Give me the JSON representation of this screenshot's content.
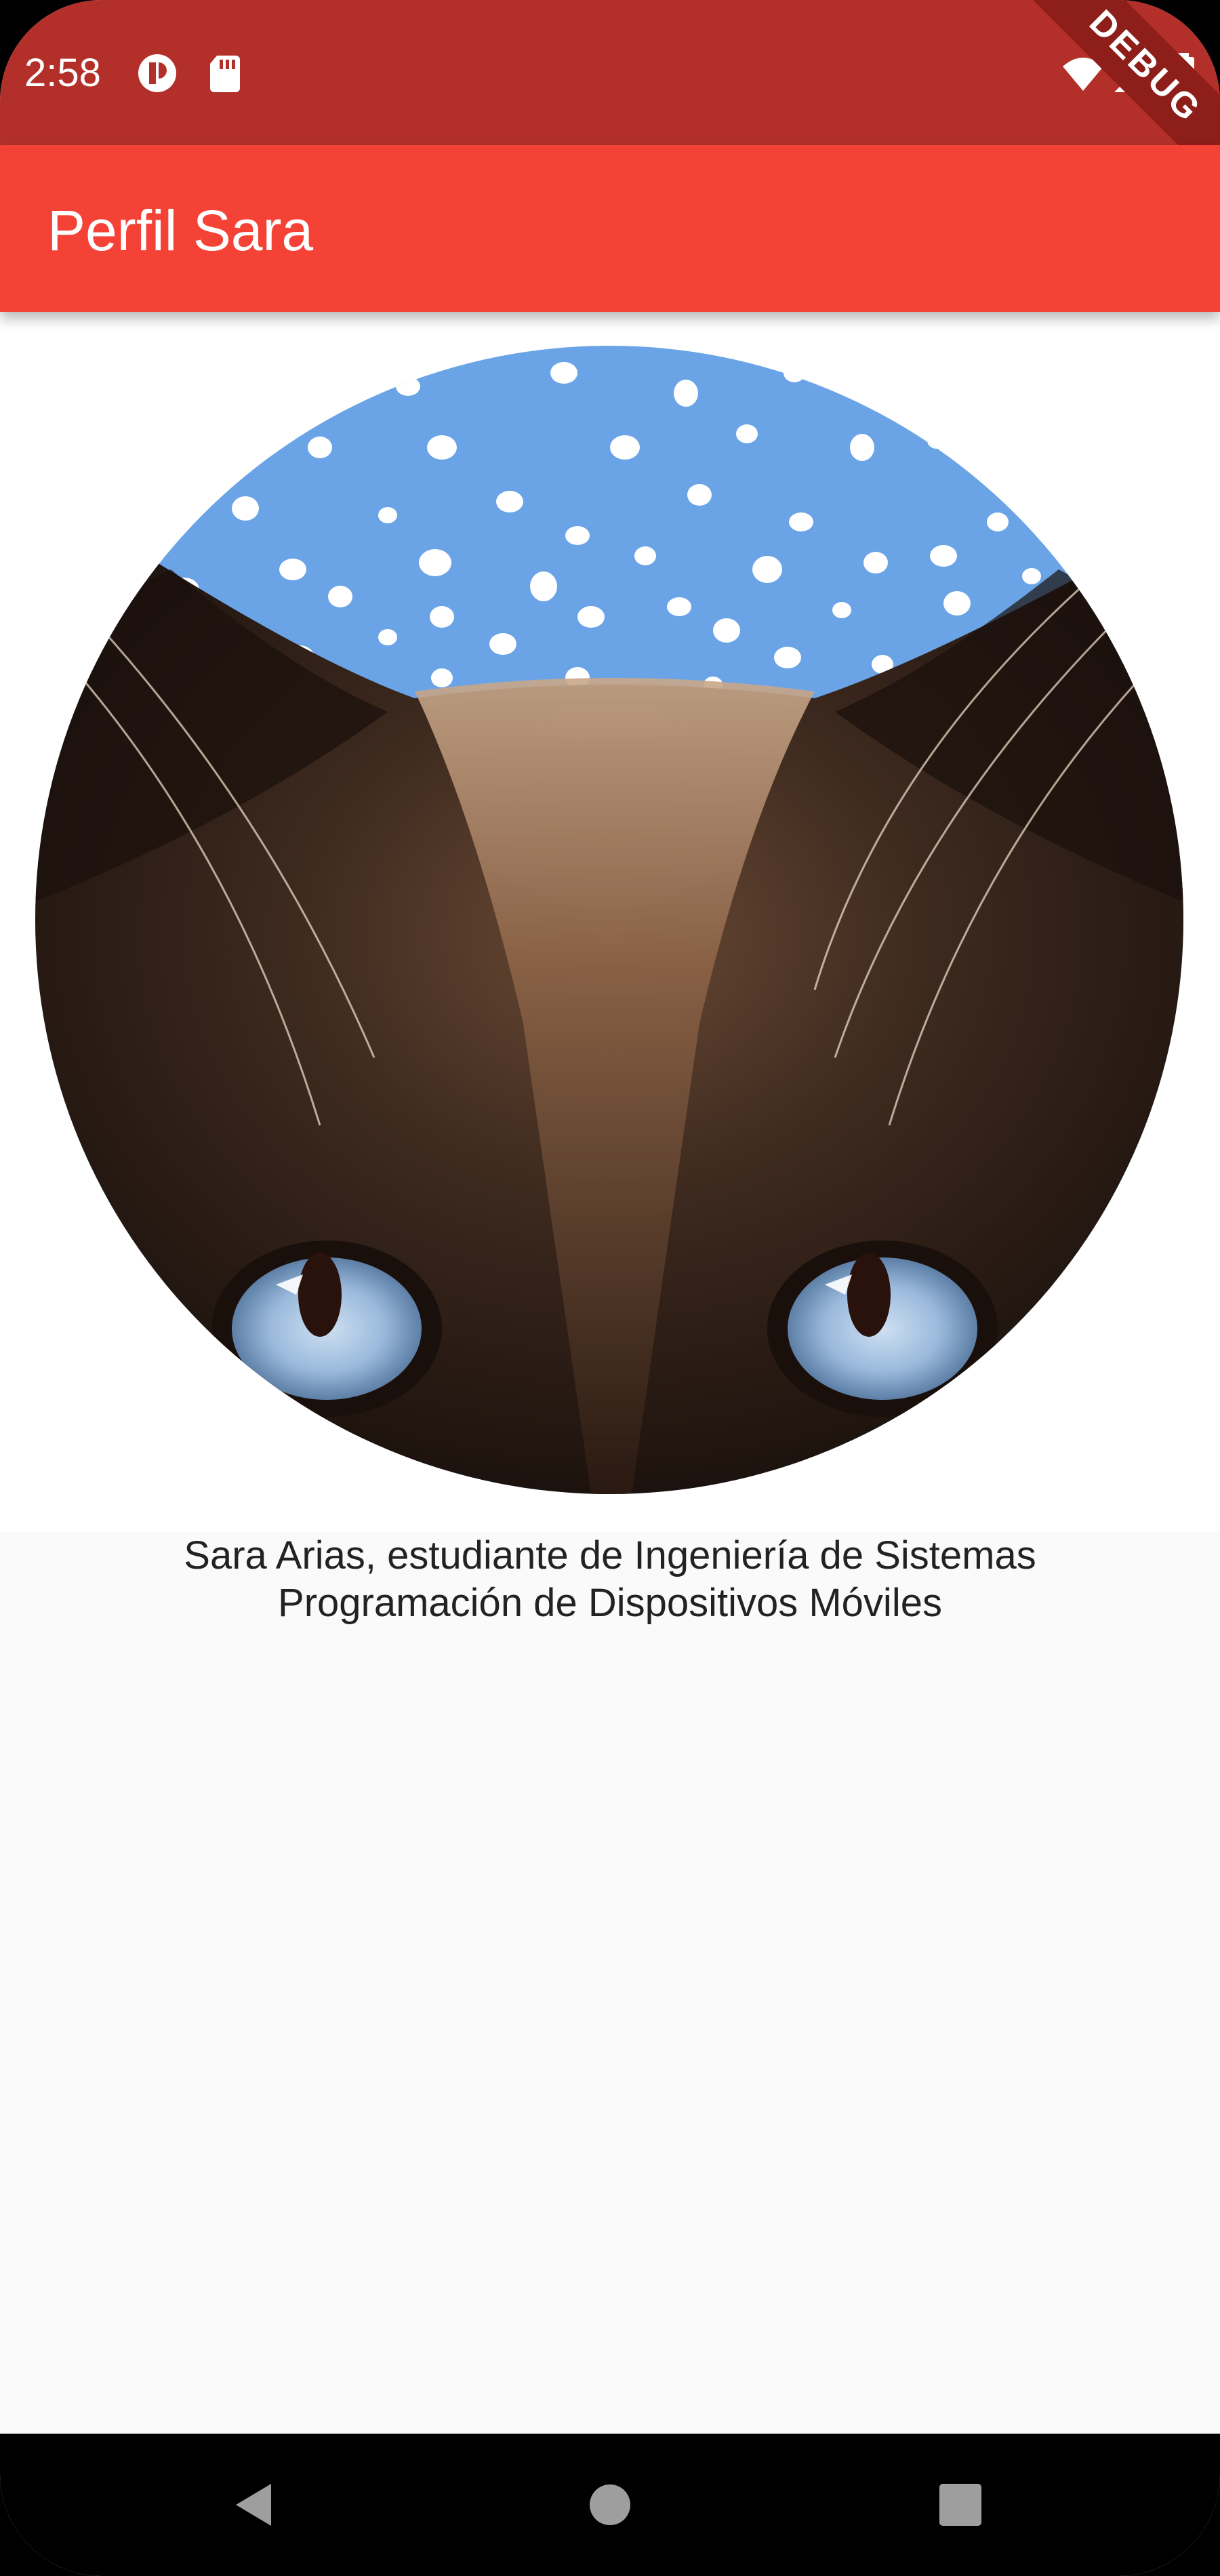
{
  "status_bar": {
    "time": "2:58",
    "icons": [
      "cast-icon",
      "sd-card-icon",
      "wifi-icon",
      "signal-icon",
      "battery-icon"
    ],
    "debug_label": "DEBUG",
    "color": "#b3302a"
  },
  "app_bar": {
    "title": "Perfil Sara",
    "color": "#f44336"
  },
  "profile": {
    "image_icon": "cat-photo",
    "caption_line1": "Sara Arias, estudiante de Ingeniería de Sistemas",
    "caption_line2": "Programación de Dispositivos Móviles"
  },
  "nav_bar": {
    "buttons": [
      "back-icon",
      "home-icon",
      "recents-icon"
    ]
  }
}
